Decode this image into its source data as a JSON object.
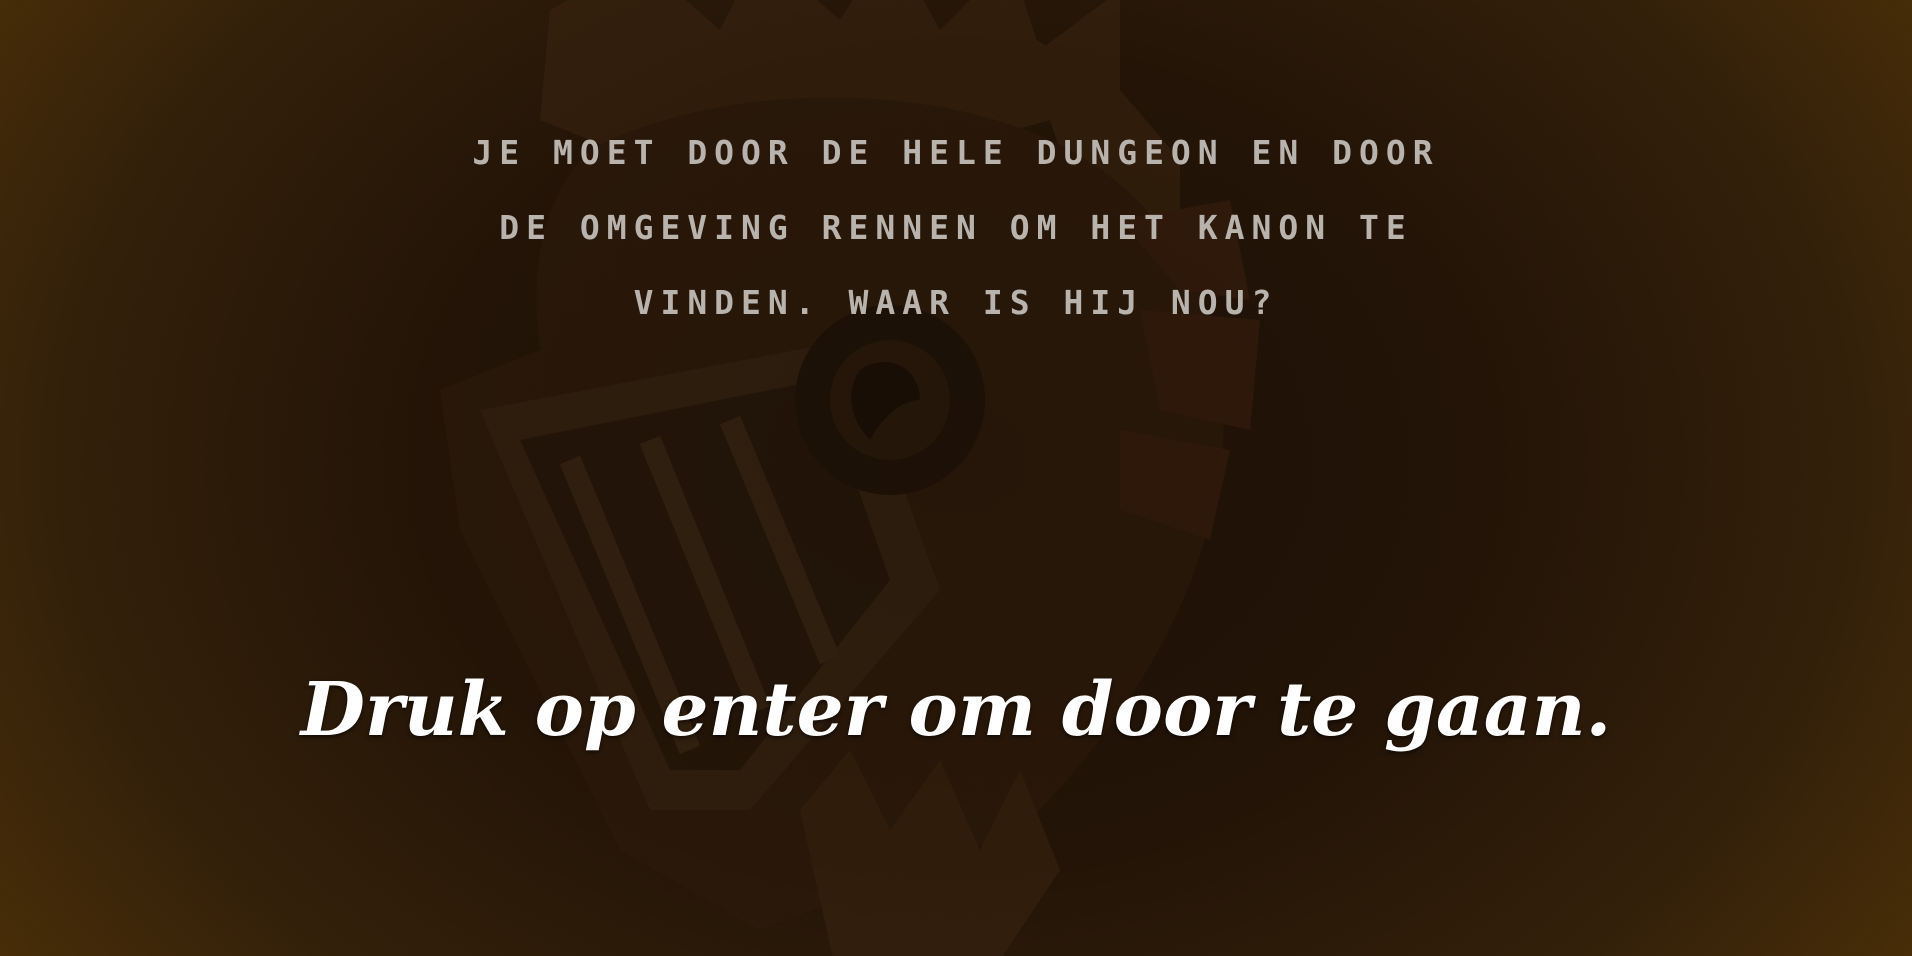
{
  "story": {
    "text": "Je moet door de hele dungeon en door de omgeving rennen om het kanon te vinden. Waar is hij nou?"
  },
  "prompt": {
    "text": "Druk op enter om door te gaan."
  },
  "colors": {
    "story_text": "#b9b3ad",
    "prompt_text": "#ffffff",
    "background_center": "#1c1006",
    "background_edge": "#4a2f08"
  },
  "icons": {
    "emblem": "knight-helmet-icon"
  }
}
